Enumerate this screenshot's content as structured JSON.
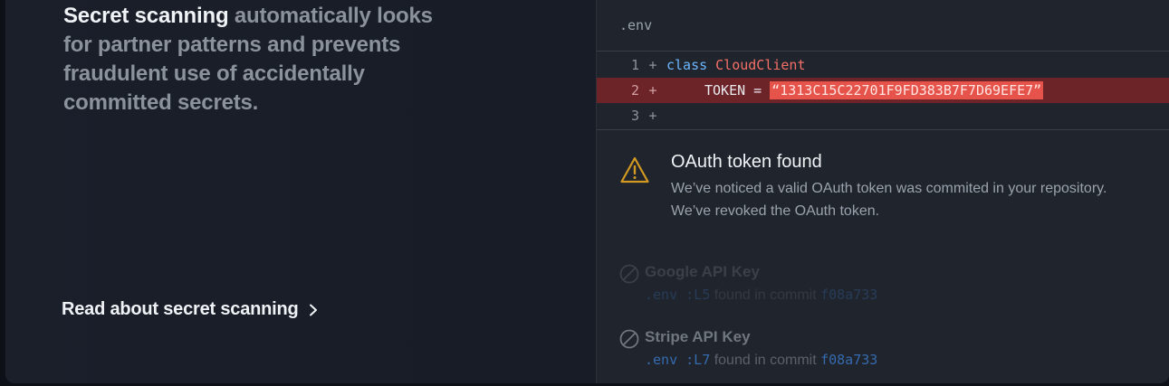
{
  "left": {
    "heading_highlight": "Secret scanning",
    "heading_rest": " automatically looks for partner patterns and prevents fraudulent use of accidentally committed secrets.",
    "link_label": "Read about secret scanning"
  },
  "file": {
    "name": ".env",
    "lines": [
      {
        "number": "1",
        "marker": "+",
        "keyword": "class",
        "class_name": "CloudClient"
      },
      {
        "number": "2",
        "marker": "+",
        "identifier": "TOKEN",
        "operator": "=",
        "string": "“1313C15C22701F9FD383B7F7D69EFE7”"
      },
      {
        "number": "3",
        "marker": "+"
      }
    ]
  },
  "alert": {
    "title": "OAuth token found",
    "line1": "We’ve noticed a valid OAuth token was commited in your repository.",
    "line2": "We’ve revoked the OAuth token."
  },
  "secrets": [
    {
      "name": "Google API Key",
      "location": ".env :L5",
      "found_text": "found in commit",
      "commit": "f08a733"
    },
    {
      "name": "Stripe API Key",
      "location": ".env :L7",
      "found_text": "found in commit",
      "commit": "f08a733"
    }
  ],
  "colors": {
    "highlight_line": "#6c2429",
    "secret_string": "#e5534b",
    "warning": "#d29922",
    "link_blue": "#3d82d9"
  },
  "icons": {
    "alert": "warning-triangle-icon",
    "secret": "slash-circle-icon",
    "link": "chevron-right-icon"
  }
}
